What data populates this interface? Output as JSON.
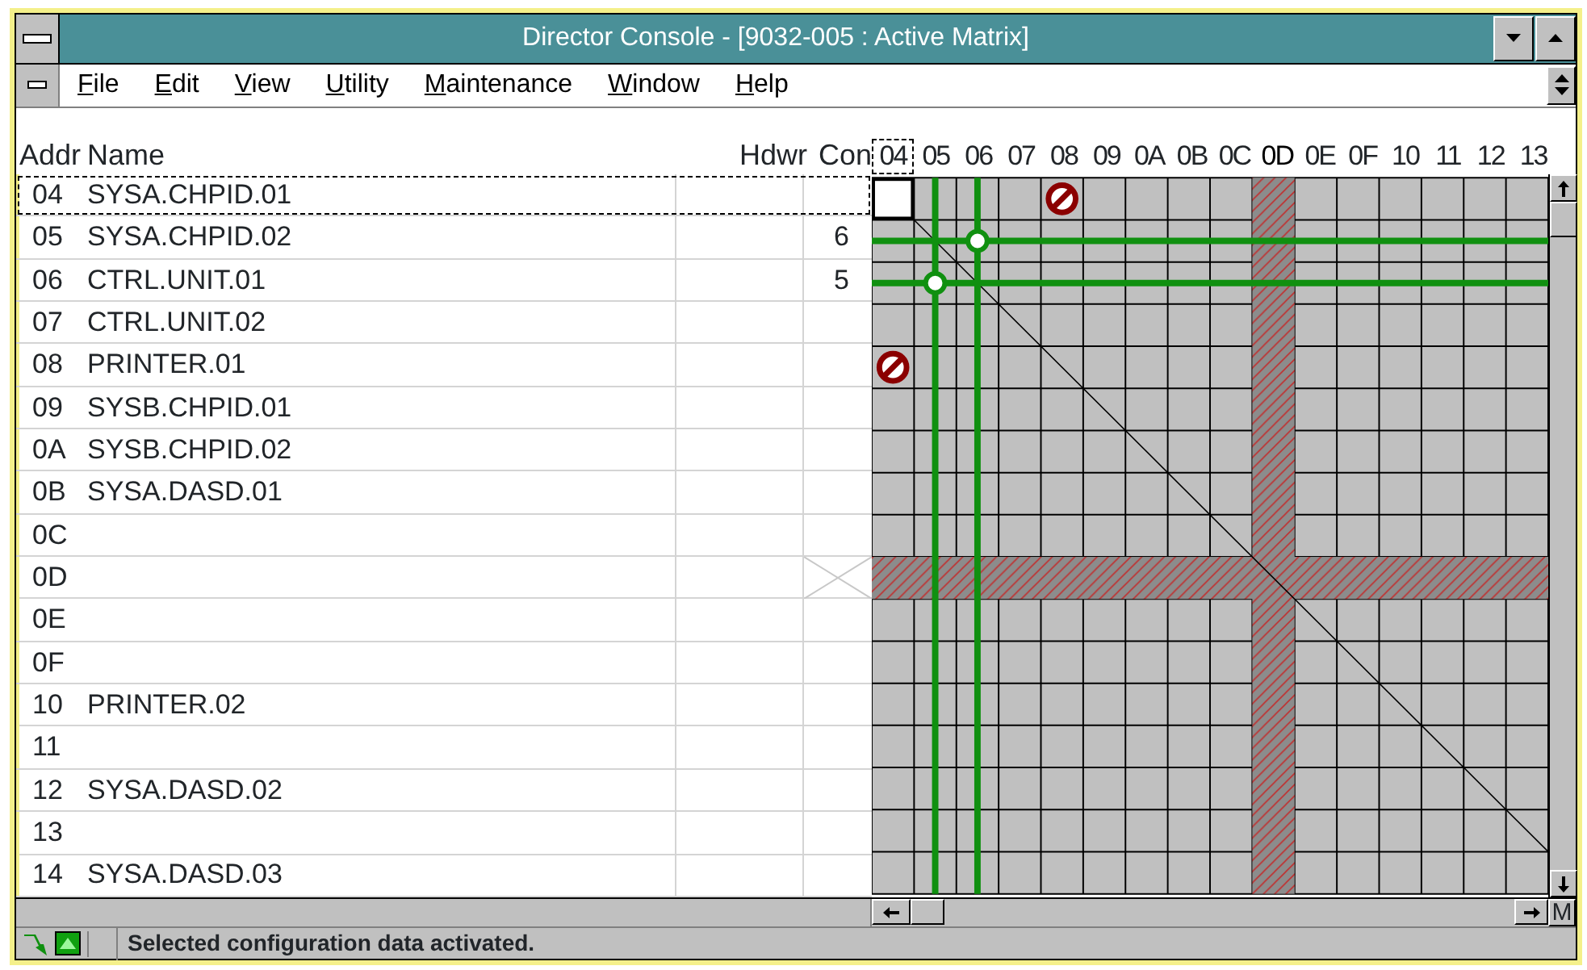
{
  "window": {
    "title": "Director Console - [9032-005 : Active Matrix]"
  },
  "menu": [
    "File",
    "Edit",
    "View",
    "Utility",
    "Maintenance",
    "Window",
    "Help"
  ],
  "table": {
    "columns": [
      "Addr",
      "Name",
      "Hdwr",
      "Con"
    ],
    "rows": [
      {
        "addr": "04",
        "name": "SYSA.CHPID.01",
        "selected": true,
        "blocked": false,
        "cells": [
          {
            "kind": "open"
          },
          {
            "kind": "open"
          },
          {
            "kind": "open"
          },
          {
            "kind": "open"
          },
          {
            "kind": "prohibited"
          },
          {
            "kind": "open"
          },
          {
            "kind": "open"
          },
          {
            "kind": "open"
          },
          {
            "kind": "open"
          },
          {
            "kind": "open"
          },
          {
            "kind": "open"
          },
          {
            "kind": "open"
          },
          {
            "kind": "open"
          },
          {
            "kind": "open"
          },
          {
            "kind": "open"
          },
          {
            "kind": "open"
          }
        ]
      },
      {
        "addr": "05",
        "name": "SYSA.CHPID.02",
        "con": "6",
        "selected": false,
        "blocked": false,
        "cells": [
          {
            "kind": "open"
          },
          {
            "kind": "open"
          },
          {
            "kind": "connected"
          },
          {
            "kind": "open"
          },
          {
            "kind": "open"
          },
          {
            "kind": "open"
          },
          {
            "kind": "open"
          },
          {
            "kind": "open"
          },
          {
            "kind": "open"
          },
          {
            "kind": "open"
          },
          {
            "kind": "open"
          },
          {
            "kind": "open"
          },
          {
            "kind": "open"
          },
          {
            "kind": "open"
          },
          {
            "kind": "open"
          },
          {
            "kind": "open"
          }
        ]
      },
      {
        "addr": "06",
        "name": "CTRL.UNIT.01",
        "con": "5",
        "selected": false,
        "blocked": false,
        "cells": [
          {
            "kind": "open"
          },
          {
            "kind": "connected"
          },
          {
            "kind": "open"
          },
          {
            "kind": "open"
          },
          {
            "kind": "open"
          },
          {
            "kind": "open"
          },
          {
            "kind": "open"
          },
          {
            "kind": "open"
          },
          {
            "kind": "open"
          },
          {
            "kind": "open"
          },
          {
            "kind": "open"
          },
          {
            "kind": "open"
          },
          {
            "kind": "open"
          },
          {
            "kind": "open"
          },
          {
            "kind": "open"
          },
          {
            "kind": "open"
          }
        ]
      },
      {
        "addr": "07",
        "name": "CTRL.UNIT.02",
        "selected": false,
        "blocked": false
      },
      {
        "addr": "08",
        "name": "PRINTER.01",
        "selected": false,
        "blocked": false,
        "cells": [
          {
            "kind": "prohibited"
          },
          {
            "kind": "open"
          },
          {
            "kind": "open"
          },
          {
            "kind": "open"
          },
          {
            "kind": "open"
          },
          {
            "kind": "open"
          },
          {
            "kind": "open"
          },
          {
            "kind": "open"
          },
          {
            "kind": "open"
          },
          {
            "kind": "open"
          },
          {
            "kind": "open"
          },
          {
            "kind": "open"
          },
          {
            "kind": "open"
          },
          {
            "kind": "open"
          },
          {
            "kind": "open"
          },
          {
            "kind": "open"
          }
        ]
      },
      {
        "addr": "09",
        "name": "SYSB.CHPID.01",
        "selected": false,
        "blocked": false
      },
      {
        "addr": "0A",
        "name": "SYSB.CHPID.02",
        "selected": false,
        "blocked": false
      },
      {
        "addr": "0B",
        "name": "SYSA.DASD.01",
        "selected": false,
        "blocked": false
      },
      {
        "addr": "0C",
        "selected": false,
        "blocked": false
      },
      {
        "addr": "0D",
        "selected": false,
        "blocked": true
      },
      {
        "addr": "0E",
        "selected": false,
        "blocked": false
      },
      {
        "addr": "0F",
        "selected": false,
        "blocked": false
      },
      {
        "addr": "10",
        "name": "PRINTER.02",
        "selected": false,
        "blocked": false
      },
      {
        "addr": "11",
        "selected": false,
        "blocked": false
      },
      {
        "addr": "12",
        "name": "SYSA.DASD.02",
        "selected": false,
        "blocked": false
      },
      {
        "addr": "13",
        "selected": false,
        "blocked": false
      },
      {
        "addr": "14",
        "name": "SYSA.DASD.03",
        "selected": false,
        "blocked": false
      }
    ]
  },
  "matrix": {
    "columns": [
      {
        "label": "04",
        "selected": true,
        "blocked": false
      },
      {
        "label": "05",
        "selected": false,
        "blocked": false
      },
      {
        "label": "06",
        "selected": false,
        "blocked": false
      },
      {
        "label": "07",
        "selected": false,
        "blocked": false
      },
      {
        "label": "08",
        "selected": false,
        "blocked": false
      },
      {
        "label": "09",
        "selected": false,
        "blocked": false
      },
      {
        "label": "0A",
        "selected": false,
        "blocked": false
      },
      {
        "label": "0B",
        "selected": false,
        "blocked": false
      },
      {
        "label": "0C",
        "selected": false,
        "blocked": false
      },
      {
        "label": "0D",
        "selected": false,
        "blocked": true
      },
      {
        "label": "0E",
        "selected": false,
        "blocked": false
      },
      {
        "label": "0F",
        "selected": false,
        "blocked": false
      },
      {
        "label": "10",
        "selected": false,
        "blocked": false
      },
      {
        "label": "11",
        "selected": false,
        "blocked": false
      },
      {
        "label": "12",
        "selected": false,
        "blocked": false
      },
      {
        "label": "13",
        "selected": false,
        "blocked": false
      }
    ],
    "corner_label": "M"
  },
  "status_bar": {
    "text": "Selected configuration data activated."
  }
}
